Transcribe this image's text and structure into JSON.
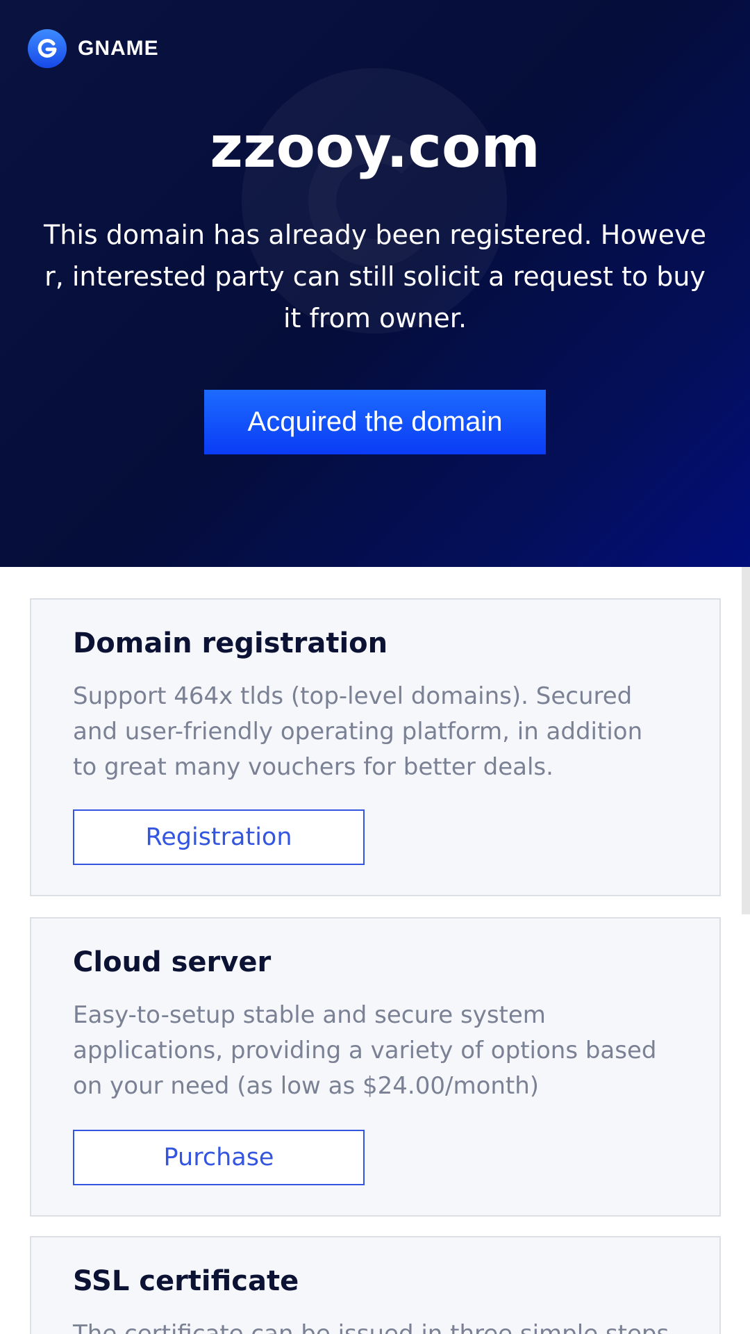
{
  "header": {
    "logo_text": "GNAME",
    "logo_icon": "gname-g-logo-icon"
  },
  "hero": {
    "domain": "zzooy.com",
    "message": "This domain has already been registered. However, interested party can still solicit a request to buy it from owner.",
    "cta_label": "Acquired the domain",
    "colors": {
      "background": "#050d3a",
      "button": "#1452ff"
    }
  },
  "cards": [
    {
      "title": "Domain registration",
      "description": "Support 464x tlds (top-level domains). Secured and user-friendly operating platform, in addition to great many vouchers for better deals.",
      "button_label": "Registration"
    },
    {
      "title": "Cloud server",
      "description": "Easy-to-setup stable and secure system applications, providing a variety of options based on your need (as low as $24.00/month)",
      "button_label": "Purchase"
    },
    {
      "title": "SSL certificate",
      "description": "The certificate can be issued in three simple steps"
    }
  ],
  "colors": {
    "accent": "#3355e0",
    "card_bg": "#f6f7fb",
    "title": "#0b1233",
    "body_text": "#7b8194"
  }
}
